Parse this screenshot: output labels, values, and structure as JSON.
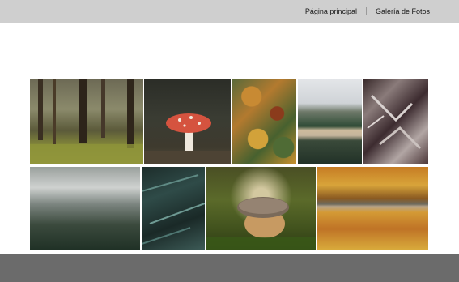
{
  "header": {
    "nav": {
      "home_label": "Página principal",
      "gallery_label": "Galería de Fotos"
    }
  },
  "gallery": {
    "photos": [
      {
        "subject": "misty forest with green undergrowth"
      },
      {
        "subject": "red fly agaric mushroom"
      },
      {
        "subject": "aerial autumn forest"
      },
      {
        "subject": "mountain lake with fog"
      },
      {
        "subject": "frosty fern leaves"
      },
      {
        "subject": "foggy pine forest"
      },
      {
        "subject": "fir branch needles"
      },
      {
        "subject": "acorn on moss"
      },
      {
        "subject": "aerial autumn forest with road"
      }
    ]
  },
  "colors": {
    "header_bg": "#cfcfcf",
    "footer_bg": "#6b6b6b",
    "page_bg": "#ffffff",
    "nav_text": "#1a1a1a"
  }
}
